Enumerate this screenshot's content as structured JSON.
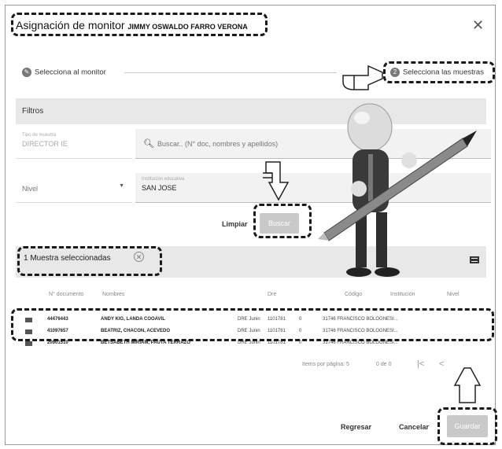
{
  "dialog": {
    "title": "Asignación de monitor",
    "monitor_name": "JIMMY OSWALDO FARRO VERONA",
    "close_icon": "close-icon"
  },
  "stepper": {
    "step1_label": "Selecciona al monitor",
    "step2_number": "2",
    "step2_label": "Selecciona las muestras"
  },
  "filters": {
    "section_label": "Filtros",
    "tipo_label": "Tipo de muestra",
    "tipo_value": "DIRECTOR IE",
    "search_placeholder": "Buscar.. (N° doc, nombres y apellidos)",
    "nivel_placeholder": "Nivel",
    "institucion_label": "Institución educativa",
    "institucion_value": "SAN JOSE",
    "limpiar_label": "Limpiar",
    "buscar_label": "Buscar"
  },
  "selection": {
    "text": "1 Muestra seleccionadas",
    "clear_icon": "clear-circle-icon"
  },
  "table": {
    "headers": [
      "N° documento",
      "Nombres",
      "Dre",
      "Código",
      "Institución",
      "Nivel"
    ],
    "rows": [
      {
        "doc": "44476443",
        "name": "ANDY KIG, LANDA COOAVIL",
        "dre": "DRE Junin",
        "code": "1101781",
        "n": "0",
        "inst": "31746 FRANCISCO BOLOGNESI..."
      },
      {
        "doc": "41097657",
        "name": "BEATRIZ, CHACON, ACEVEDO",
        "dre": "DRE Junin",
        "code": "1101781",
        "n": "0",
        "inst": "31746 FRANCISCO BOLOGNESI..."
      },
      {
        "doc": "20901510",
        "name": "BETSABETH MIRIAM, PAUTA TERRAZO",
        "dre": "DRE Junin",
        "code": "1101781",
        "n": "0",
        "inst": "31746 FRANCISCO BOLOGNESI..."
      }
    ]
  },
  "pagination": {
    "items_label": "Items por página: 5",
    "range": "0 de 0",
    "first_icon": "|<",
    "prev_icon": "<"
  },
  "footer": {
    "regresar_label": "Regresar",
    "cancelar_label": "Cancelar",
    "guardar_label": "Guardar"
  }
}
